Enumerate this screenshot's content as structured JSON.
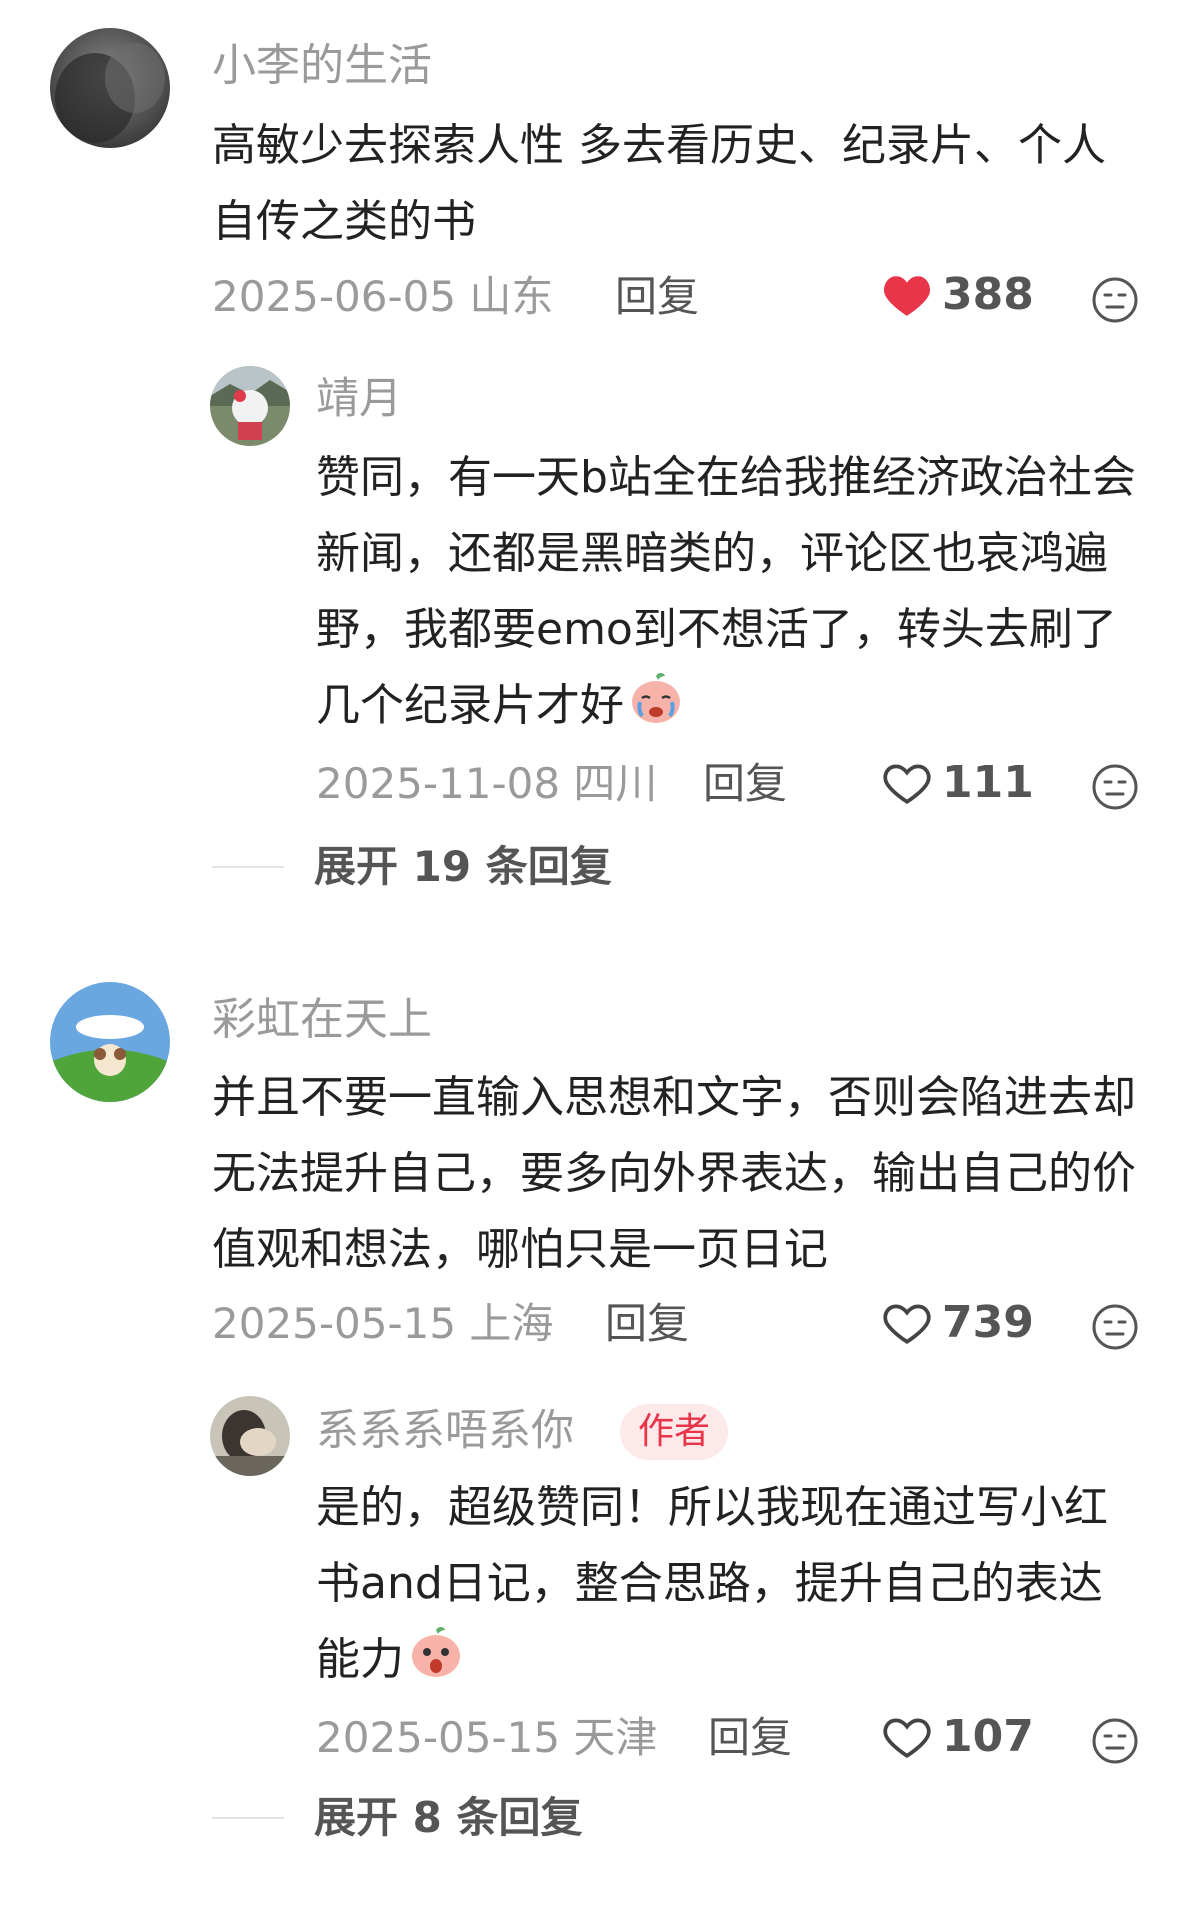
{
  "comments": [
    {
      "username": "小李的生活",
      "text": "高敏少去探索人性 多去看历史、纪录片、个人自传之类的书",
      "date_location": "2025-06-05 山东",
      "reply_label": "回复",
      "likes": "388",
      "liked": true,
      "replies": [
        {
          "username": "靖月",
          "text": "赞同，有一天b站全在给我推经济政治社会新闻，还都是黑暗类的，评论区也哀鸿遍野，我都要emo到不想活了，转头去刷了几个纪录片才好",
          "emoji": "crying-peach-emoji",
          "date_location": "2025-11-08 四川",
          "reply_label": "回复",
          "likes": "111"
        }
      ],
      "expand_label": "展开 19 条回复"
    },
    {
      "username": "彩虹在天上",
      "text": "并且不要一直输入思想和文字，否则会陷进去却无法提升自己，要多向外界表达，输出自己的价值观和想法，哪怕只是一页日记",
      "date_location": "2025-05-15 上海",
      "reply_label": "回复",
      "likes": "739",
      "liked": false,
      "replies": [
        {
          "username": "系系系唔系你",
          "badge": "作者",
          "text": "是的，超级赞同！所以我现在通过写小红书and日记，整合思路，提升自己的表达能力",
          "emoji": "shocked-peach-emoji",
          "date_location": "2025-05-15 天津",
          "reply_label": "回复",
          "likes": "107"
        }
      ],
      "expand_label": "展开 8 条回复"
    }
  ],
  "colors": {
    "liked_heart": "#e8354a",
    "muted": "#9a9a9a",
    "badge_bg": "#fde8ea",
    "badge_text": "#e8354a"
  }
}
